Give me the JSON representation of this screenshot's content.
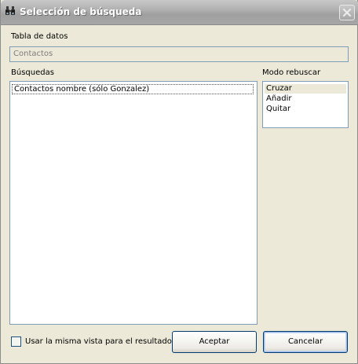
{
  "window": {
    "title": "Selección de búsqueda"
  },
  "data_table": {
    "label": "Tabla de datos",
    "value": "Contactos"
  },
  "searches": {
    "label": "Búsquedas",
    "items": [
      "Contactos nombre (sólo Gonzalez)"
    ]
  },
  "research_mode": {
    "label": "Modo rebuscar",
    "options": [
      "Cruzar",
      "Añadir",
      "Quitar"
    ],
    "selected": "Cruzar"
  },
  "same_view": {
    "label": "Usar la misma vista para el resultado",
    "checked": false
  },
  "buttons": {
    "accept": "Aceptar",
    "cancel": "Cancelar"
  },
  "icons": {
    "title": "binoculars-icon",
    "close": "close-icon"
  }
}
